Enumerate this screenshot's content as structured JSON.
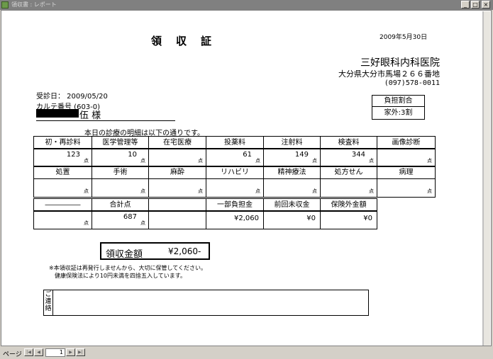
{
  "window": {
    "title": "領収書 : レポート"
  },
  "receipt": {
    "title": "領収証",
    "issue_date": "2009年5月30日",
    "clinic_name": "三好眼科内科医院",
    "clinic_address": "大分県大分市馬場２６６番地",
    "clinic_phone": "(097)578-0011",
    "visit_date": "受診日： 2009/05/20",
    "chart_no": "カルテ番号 (603-0)",
    "patient_name": "伍 様",
    "burden_label": "負担割合",
    "burden_value": "家外:3割",
    "detail_intro": "本日の診療の明細は以下の通りです。",
    "unit": "点",
    "row1_headers": [
      "初・再診料",
      "医学管理等",
      "在宅医療",
      "投薬料",
      "注射料",
      "検査料",
      "画像診断"
    ],
    "row1_values": [
      "123",
      "10",
      "",
      "61",
      "149",
      "344",
      ""
    ],
    "row2_headers": [
      "処置",
      "手術",
      "麻酔",
      "リハビリ",
      "精神療法",
      "処方せん",
      "病理"
    ],
    "row2_values": [
      "",
      "",
      "",
      "",
      "",
      "",
      ""
    ],
    "row3_headers": [
      "―――――",
      "合計点",
      "",
      "一部負担金",
      "前回未収金",
      "保険外金額"
    ],
    "row3_values": [
      "",
      "687",
      "",
      "¥2,060",
      "¥0",
      "¥0"
    ],
    "total_label": "領収金額",
    "total_amount": "¥2,060-",
    "note_1": "※本領収証は再発行しませんから、大切に保管してください。",
    "note_2": "健康保険法により10円未満を四捨五入しています。",
    "contact_label": "ご連絡"
  },
  "statusbar": {
    "page_label": "ページ",
    "page_number": "1"
  }
}
